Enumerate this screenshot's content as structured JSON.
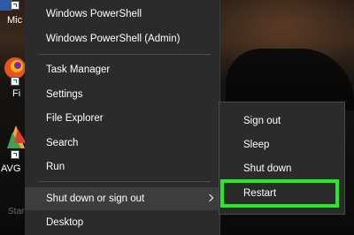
{
  "desktop_icons": [
    {
      "label": "Mic",
      "icon": "microsoft-edge-icon"
    },
    {
      "label": "Fi",
      "icon": "firefox-icon"
    },
    {
      "label": "AVG",
      "icon": "avg-antivirus-icon"
    }
  ],
  "menu": {
    "items": [
      {
        "label": "Windows PowerShell"
      },
      {
        "label": "Windows PowerShell (Admin)"
      },
      {
        "label": "Task Manager"
      },
      {
        "label": "Settings"
      },
      {
        "label": "File Explorer"
      },
      {
        "label": "Search"
      },
      {
        "label": "Run"
      },
      {
        "label": "Shut down or sign out"
      },
      {
        "label": "Desktop"
      }
    ]
  },
  "submenu": {
    "items": [
      {
        "label": "Sign out"
      },
      {
        "label": "Sleep"
      },
      {
        "label": "Shut down"
      },
      {
        "label": "Restart"
      }
    ]
  },
  "start_label": "Start",
  "colors": {
    "menu_bg": "#2b2b2b",
    "hover_bg": "#3d3d3d",
    "highlight": "#22ee22"
  }
}
